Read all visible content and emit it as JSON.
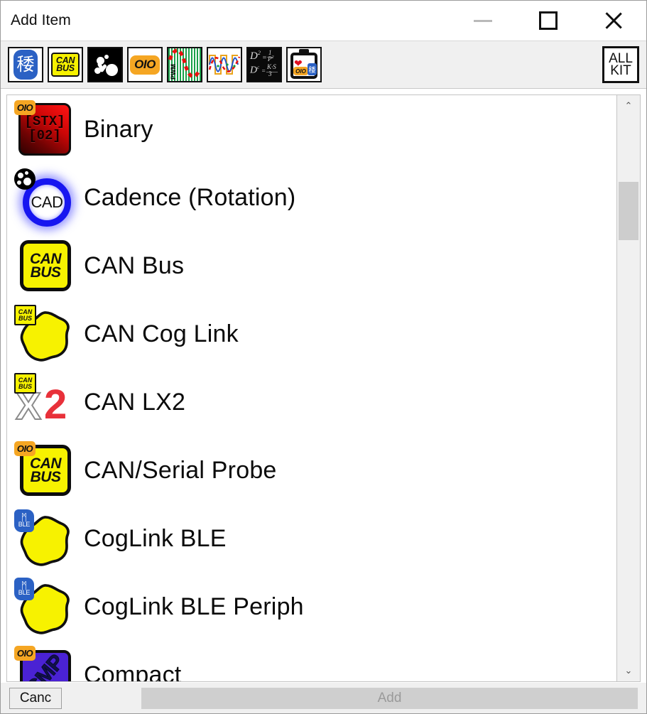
{
  "window": {
    "title": "Add Item",
    "controls": {
      "minimize": "minimize",
      "maximize": "maximize",
      "close": "close"
    }
  },
  "toolbar": {
    "filters": [
      {
        "id": "bluetooth",
        "icon": "bluetooth-icon",
        "label": "Bluetooth"
      },
      {
        "id": "canbus",
        "icon": "canbus-icon",
        "label": "CAN BUS"
      },
      {
        "id": "molecule",
        "icon": "molecule-icon",
        "label": "Molecule"
      },
      {
        "id": "oio",
        "icon": "oio-icon",
        "label": "OIO"
      },
      {
        "id": "pwm",
        "icon": "pwm-icon",
        "label": "PWM"
      },
      {
        "id": "waveform",
        "icon": "waveform-icon",
        "label": "Waveform"
      },
      {
        "id": "math",
        "icon": "math-formula-icon",
        "label": "Math"
      },
      {
        "id": "clipboard",
        "icon": "clipboard-heart-icon",
        "label": "Clipboard"
      }
    ],
    "allkit": {
      "line1": "ALL",
      "line2": "KIT"
    }
  },
  "list": {
    "items": [
      {
        "label": "Binary",
        "icon": "binary-icon",
        "badge": "oio",
        "tile_text_1": "[STX]",
        "tile_text_2": "[02]"
      },
      {
        "label": "Cadence (Rotation)",
        "icon": "cadence-icon",
        "badge": "molecule",
        "tile_text_1": "CAD",
        "tile_text_2": ""
      },
      {
        "label": "CAN Bus",
        "icon": "canbus-icon",
        "badge": "",
        "tile_text_1": "CAN",
        "tile_text_2": "BUS"
      },
      {
        "label": "CAN Cog Link",
        "icon": "cog-icon",
        "badge": "canbus",
        "tile_text_1": "",
        "tile_text_2": ""
      },
      {
        "label": "CAN LX2",
        "icon": "x2-icon",
        "badge": "canbus",
        "tile_text_1": "X",
        "tile_text_2": "2"
      },
      {
        "label": "CAN/Serial Probe",
        "icon": "canbus-icon",
        "badge": "oio",
        "tile_text_1": "CAN",
        "tile_text_2": "BUS"
      },
      {
        "label": "CogLink BLE",
        "icon": "cog-icon",
        "badge": "ble",
        "tile_text_1": "",
        "tile_text_2": ""
      },
      {
        "label": "CogLink BLE Periph",
        "icon": "cog-icon",
        "badge": "ble",
        "tile_text_1": "",
        "tile_text_2": ""
      },
      {
        "label": "Compact",
        "icon": "compact-icon",
        "badge": "oio",
        "tile_text_1": "CMP",
        "tile_text_2": ""
      }
    ]
  },
  "badges": {
    "oio": "OIO",
    "canbus_line1": "CAN",
    "canbus_line2": "BUS",
    "ble_symbol": "ᛗ",
    "ble_label": "BLE"
  },
  "scrollbar": {
    "up": "⌃",
    "down": "⌄"
  },
  "footer": {
    "cancel_label": "Canc",
    "add_label": "Add"
  },
  "colors": {
    "accent_yellow": "#f7f200",
    "accent_blue": "#2b61c4",
    "accent_orange": "#f5a623",
    "accent_red": "#e8313a",
    "accent_purple": "#4a22d4",
    "toolbar_bg": "#f0f0f0",
    "window_bg": "#ffffff"
  }
}
